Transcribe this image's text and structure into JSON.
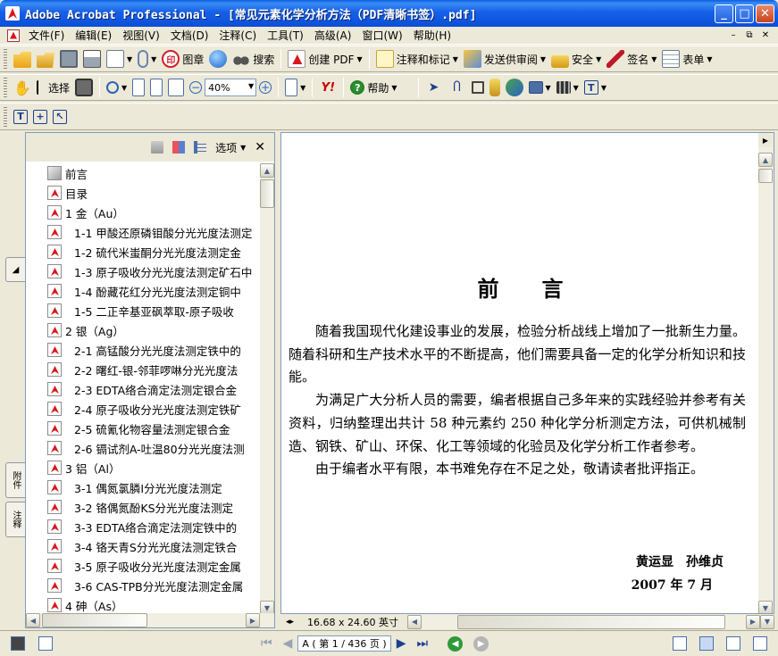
{
  "window": {
    "title": "Adobe Acrobat Professional - [常见元素化学分析方法（PDF清晰书签）.pdf]",
    "minimize": "_",
    "maximize": "□",
    "close": "✕"
  },
  "menu": {
    "items": [
      "文件(F)",
      "编辑(E)",
      "视图(V)",
      "文档(D)",
      "注释(C)",
      "工具(T)",
      "高级(A)",
      "窗口(W)",
      "帮助(H)"
    ],
    "mdi": [
      "–",
      "⧉",
      "✕"
    ]
  },
  "toolbar1": {
    "stamp": "图章",
    "search": "搜索",
    "create_pdf": "创建 PDF",
    "comment": "注释和标记",
    "send_review": "发送供审阅",
    "security": "安全",
    "sign": "签名",
    "forms": "表单"
  },
  "toolbar2": {
    "select": "选择",
    "zoom": "40%",
    "help": "帮助"
  },
  "bookmarks": {
    "options": "选项",
    "items": [
      {
        "label": "前言",
        "level": 0,
        "icon": "page"
      },
      {
        "label": "目录",
        "level": 0,
        "icon": "pdf"
      },
      {
        "label": "1 金（Au）",
        "level": 0,
        "icon": "pdf"
      },
      {
        "label": "1-1  甲酸还原磷钼酸分光光度法测定",
        "level": 1,
        "icon": "pdf"
      },
      {
        "label": "1-2  硫代米蚩酮分光光度法测定金",
        "level": 1,
        "icon": "pdf"
      },
      {
        "label": "1-3  原子吸收分光光度法测定矿石中",
        "level": 1,
        "icon": "pdf"
      },
      {
        "label": "1-4  酚藏花红分光光度法测定铜中",
        "level": 1,
        "icon": "pdf"
      },
      {
        "label": "1-5  二正辛基亚砜萃取-原子吸收",
        "level": 1,
        "icon": "pdf"
      },
      {
        "label": "2 银（Ag）",
        "level": 0,
        "icon": "pdf"
      },
      {
        "label": "2-1  高锰酸分光光度法测定铁中的",
        "level": 1,
        "icon": "pdf"
      },
      {
        "label": "2-2  曙红-银-邻菲啰啉分光光度法",
        "level": 1,
        "icon": "pdf"
      },
      {
        "label": "2-3  EDTA络合滴定法测定银合金",
        "level": 1,
        "icon": "pdf"
      },
      {
        "label": "2-4  原子吸收分光光度法测定铁矿",
        "level": 1,
        "icon": "pdf"
      },
      {
        "label": "2-5  硫氰化物容量法测定银合金",
        "level": 1,
        "icon": "pdf"
      },
      {
        "label": "2-6  镉试剂A-吐温80分光光度法测",
        "level": 1,
        "icon": "pdf"
      },
      {
        "label": "3 铝（Al）",
        "level": 0,
        "icon": "pdf"
      },
      {
        "label": "3-1  偶氮氯膦Ⅰ分光光度法测定",
        "level": 1,
        "icon": "pdf"
      },
      {
        "label": "3-2  铬偶氮酚KS分光光度法测定",
        "level": 1,
        "icon": "pdf"
      },
      {
        "label": "3-3  EDTA络合滴定法测定铁中的",
        "level": 1,
        "icon": "pdf"
      },
      {
        "label": "3-4  铬天青S分光光度法测定铁合",
        "level": 1,
        "icon": "pdf"
      },
      {
        "label": "3-5  原子吸收分光光度法测定金属",
        "level": 1,
        "icon": "pdf"
      },
      {
        "label": "3-6  CAS-TPB分光光度法测定金属",
        "level": 1,
        "icon": "pdf"
      },
      {
        "label": "4 砷（As）",
        "level": 0,
        "icon": "pdf"
      }
    ]
  },
  "nav_tabs": {
    "attachments": "附件",
    "comments": "注释"
  },
  "document": {
    "heading": "前言",
    "paragraphs": [
      "随着我国现代化建设事业的发展，检验分析战线上增加了一批新生力量。随着科研和生产技术水平的不断提高，他们需要具备一定的化学分析知识和技能。",
      "为满足广大分析人员的需要，编者根据自己多年来的实践经验并参考有关资料，归纳整理出共计 58 种元素约 250 种化学分析测定方法，可供机械制造、钢铁、矿山、环保、化工等领域的化验员及化学分析工作者参考。",
      "由于编者水平有限，本书难免存在不足之处，敬请读者批评指正。"
    ],
    "authors": "黄运显　孙维贞",
    "date": "2007 年 7 月",
    "page_size": "16.68 x 24.60 英寸"
  },
  "status": {
    "page_indicator": "A ( 第 1 / 436 页 )"
  },
  "colors": {
    "titlebar": "#0b4fd6",
    "chrome": "#ece9d8",
    "accent_red": "#d8181e"
  }
}
